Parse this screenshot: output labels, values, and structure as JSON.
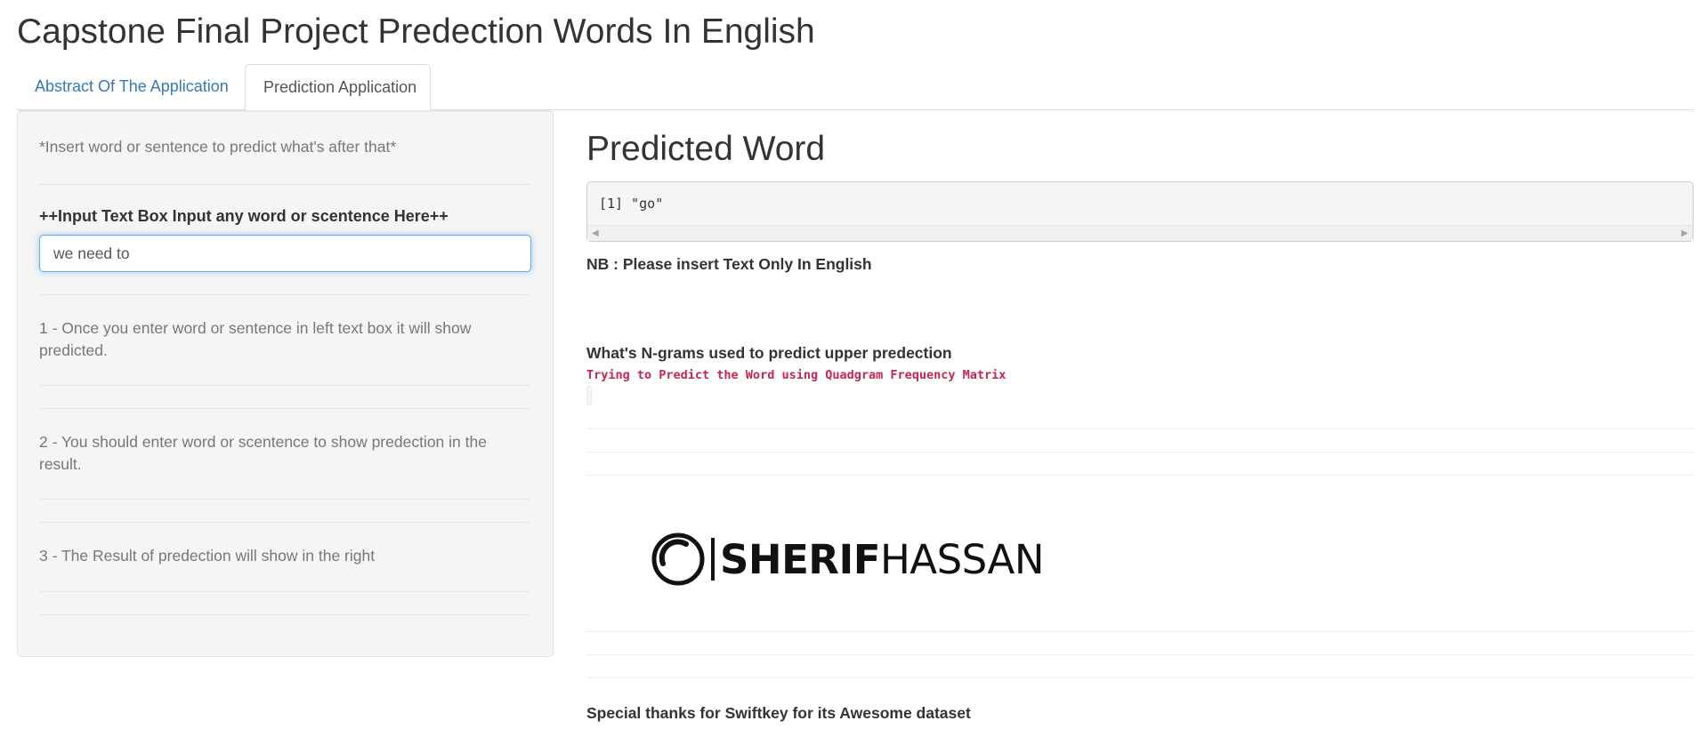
{
  "page": {
    "title": "Capstone Final Project Predection Words In English"
  },
  "tabs": [
    {
      "label": "Abstract Of The Application",
      "active": false
    },
    {
      "label": "Prediction Application",
      "active": true
    }
  ],
  "sidebar": {
    "intro": "*Insert word or sentence to predict what's after that*",
    "input_label": "++Input Text Box Input any word or scentence Here++",
    "input_value": "we need to",
    "notes": [
      "1 - Once you enter word or sentence in left text box it will show predicted.",
      "2 - You should enter word or scentence to show predection in the result.",
      "3 - The Result of predection will show in the right"
    ]
  },
  "main": {
    "heading": "Predicted Word",
    "output": "[1] \"go\"",
    "nb": "NB : Please insert Text Only In English",
    "ngram_heading": "What's N-grams used to predict upper predection",
    "ngram_output": "Trying to Predict the Word using Quadgram Frequency Matrix",
    "logo": {
      "bold": "SHERIF",
      "light": "HASSAN"
    },
    "thanks": "Special thanks for Swiftkey for its Awesome dataset"
  },
  "colors": {
    "link": "#337ab7",
    "code": "#c7254e",
    "focus": "#66afe9"
  },
  "icons": [
    "scroll-left-arrow-icon",
    "scroll-right-arrow-icon",
    "logo-ring-icon"
  ]
}
